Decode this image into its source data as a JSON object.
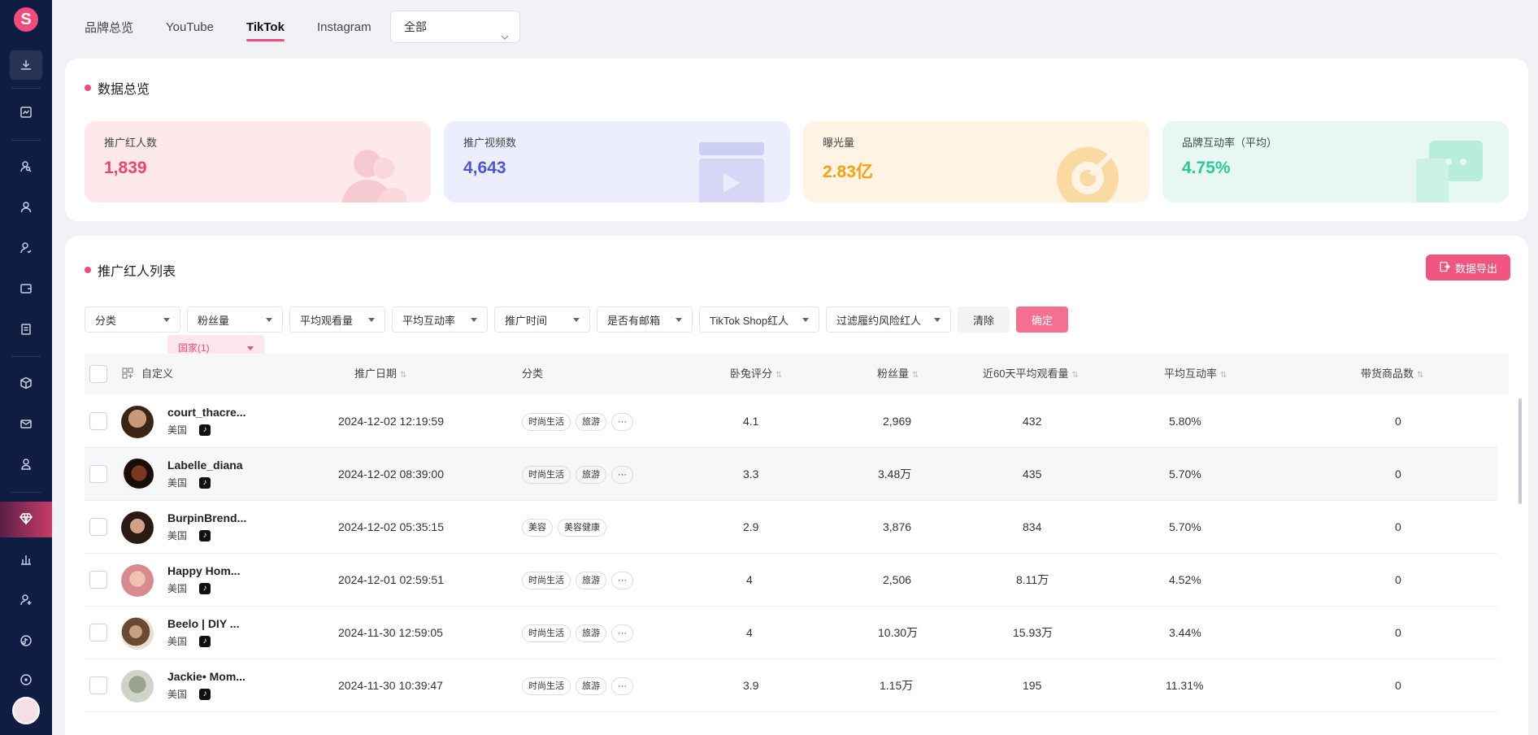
{
  "logo": "S",
  "tabs": [
    "品牌总览",
    "YouTube",
    "TikTok",
    "Instagram"
  ],
  "active_tab": "TikTok",
  "platform_select": "全部",
  "overview": {
    "title": "数据总览",
    "stats": [
      {
        "label": "推广红人数",
        "value": "1,839",
        "color": "#ef4565",
        "bg": "#fde8ec"
      },
      {
        "label": "推广视频数",
        "value": "4,643",
        "color": "#4c55d8",
        "bg": "#eceefd"
      },
      {
        "label": "曝光量",
        "value": "2.83亿",
        "color": "#f5a10f",
        "bg": "#fff4e3"
      },
      {
        "label": "品牌互动率（平均）",
        "value": "4.75%",
        "color": "#2ec79c",
        "bg": "#e7f8f2"
      }
    ]
  },
  "list": {
    "title": "推广红人列表",
    "export_label": "数据导出",
    "filters": [
      "国家(1)",
      "分类",
      "粉丝量",
      "平均观看量",
      "平均互动率",
      "推广时间",
      "是否有邮箱",
      "TikTok Shop红人",
      "过滤履约风险红人"
    ],
    "clear_label": "清除",
    "ok_label": "确定",
    "columns": [
      "自定义",
      "推广日期",
      "分类",
      "卧兔评分",
      "粉丝量",
      "近60天平均观看量",
      "平均互动率",
      "带货商品数"
    ],
    "rows": [
      {
        "name": "court_thacre...",
        "country": "美国",
        "date": "2024-12-02 12:19:59",
        "tags": [
          "时尚生活",
          "旅游",
          "···"
        ],
        "score": "4.1",
        "fans": "2,969",
        "views": "432",
        "rate": "5.80%",
        "goods": "0"
      },
      {
        "name": "Labelle_diana",
        "country": "美国",
        "date": "2024-12-02 08:39:00",
        "tags": [
          "时尚生活",
          "旅游",
          "···"
        ],
        "score": "3.3",
        "fans": "3.48万",
        "views": "435",
        "rate": "5.70%",
        "goods": "0"
      },
      {
        "name": "BurpinBrend...",
        "country": "美国",
        "date": "2024-12-02 05:35:15",
        "tags": [
          "美容",
          "美容健康"
        ],
        "score": "2.9",
        "fans": "3,876",
        "views": "834",
        "rate": "5.70%",
        "goods": "0"
      },
      {
        "name": "Happy Hom...",
        "country": "美国",
        "date": "2024-12-01 02:59:51",
        "tags": [
          "时尚生活",
          "旅游",
          "···"
        ],
        "score": "4",
        "fans": "2,506",
        "views": "8.11万",
        "rate": "4.52%",
        "goods": "0"
      },
      {
        "name": "Beelo | DIY ...",
        "country": "美国",
        "date": "2024-11-30 12:59:05",
        "tags": [
          "时尚生活",
          "旅游",
          "···"
        ],
        "score": "4",
        "fans": "10.30万",
        "views": "15.93万",
        "rate": "3.44%",
        "goods": "0"
      },
      {
        "name": "Jackie• Mom...",
        "country": "美国",
        "date": "2024-11-30 10:39:47",
        "tags": [
          "时尚生活",
          "旅游",
          "···"
        ],
        "score": "3.9",
        "fans": "1.15万",
        "views": "195",
        "rate": "11.31%",
        "goods": "0"
      }
    ]
  }
}
